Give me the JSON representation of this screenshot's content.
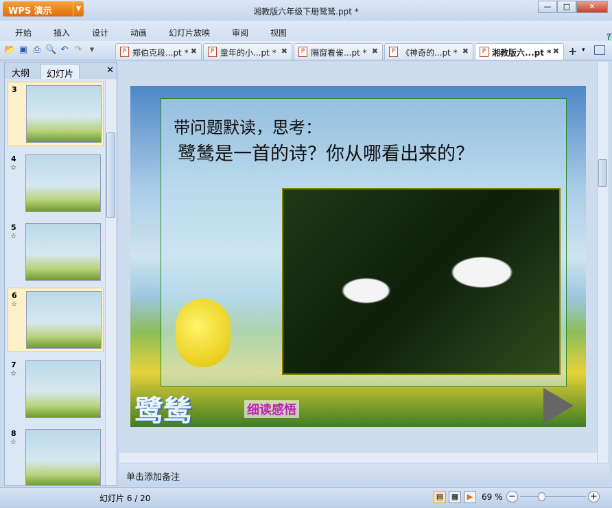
{
  "app": {
    "name": "WPS 演示",
    "title": "湘教版六年级下册鹭鸶.ppt *"
  },
  "window": {
    "minimize": "—",
    "maximize": "□",
    "close": "✕"
  },
  "menu": [
    "开始",
    "插入",
    "设计",
    "动画",
    "幻灯片放映",
    "审阅",
    "视图"
  ],
  "tabs": [
    {
      "label": "郑伯克段...pt *"
    },
    {
      "label": "童年的小...pt *"
    },
    {
      "label": "隔窗看雀...pt *"
    },
    {
      "label": "《神奇的...pt *"
    },
    {
      "label": "湘教版六...pt *",
      "active": true
    }
  ],
  "pane": {
    "tab_outline": "大纲",
    "tab_slides": "幻灯片",
    "close": "✕"
  },
  "thumbnails": [
    {
      "num": "3",
      "star": ""
    },
    {
      "num": "4",
      "star": "☆"
    },
    {
      "num": "5",
      "star": "☆"
    },
    {
      "num": "6",
      "star": "☆",
      "selected": true
    },
    {
      "num": "7",
      "star": "☆"
    },
    {
      "num": "8",
      "star": "☆"
    }
  ],
  "slide": {
    "line1": "带问题默读，思考：",
    "line2": "鹭鸶是一首的诗？你从哪看出来的？",
    "brand": "鹭鸶",
    "section": "细读感悟"
  },
  "notes": {
    "placeholder": "单击添加备注"
  },
  "status": {
    "slide_count": "幻灯片 6 / 20",
    "zoom": "69 %",
    "zoom_level_percent": 69
  },
  "colors": {
    "accent": "#e8821a",
    "frame": "#2a8a2a"
  }
}
